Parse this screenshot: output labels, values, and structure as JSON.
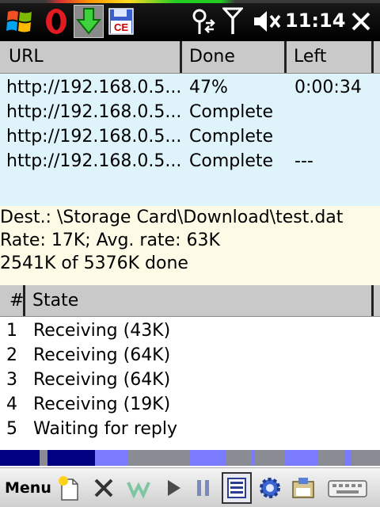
{
  "status_bar": {
    "time": "11:14",
    "icons": {
      "start": "windows-start-icon",
      "opera": "opera-browser-icon",
      "download_app": "download-manager-icon",
      "save": "floppy-ce-icon",
      "connection": "connectivity-icon",
      "signal": "signal-strength-icon",
      "volume": "speaker-muted-icon",
      "close": "close-icon"
    },
    "ce_text": "CE"
  },
  "downloads_table": {
    "columns": [
      "URL",
      "Done",
      "Left"
    ],
    "rows": [
      {
        "url": "http://192.168.0.5...",
        "done": "47%",
        "left": "0:00:34"
      },
      {
        "url": "http://192.168.0.5...",
        "done": "Complete",
        "left": ""
      },
      {
        "url": "http://192.168.0.5...",
        "done": "Complete",
        "left": ""
      },
      {
        "url": "http://192.168.0.5...",
        "done": "Complete",
        "left": "---"
      }
    ]
  },
  "info": {
    "dest": "Dest.: \\Storage Card\\Download\\test.dat",
    "rate": "Rate: 17K; Avg. rate: 63K",
    "done": "2541K of 5376K done"
  },
  "threads_table": {
    "columns": [
      "#",
      "State"
    ],
    "rows": [
      {
        "num": "1",
        "state": "Receiving (43K)"
      },
      {
        "num": "2",
        "state": "Receiving (64K)"
      },
      {
        "num": "3",
        "state": "Receiving (64K)"
      },
      {
        "num": "4",
        "state": "Receiving (19K)"
      },
      {
        "num": "5",
        "state": "Waiting for reply"
      }
    ]
  },
  "progress_map": {
    "colors": {
      "downloaded": "#000080",
      "active": "#7b7bff",
      "pending": "#8b8b93"
    }
  },
  "menu_bar": {
    "menu_label": "Menu",
    "toolbar": [
      "new-download-icon",
      "delete-icon",
      "play-icon",
      "pause-icon",
      "view-details-icon",
      "settings-gear-icon",
      "save-disk-icon",
      "keyboard-icon"
    ]
  },
  "colors": {
    "status_bar_bg": "#000000",
    "header_bg": "#c9c9c9",
    "download_list_bg": "#dff3fb",
    "info_bg": "#fdfbe6"
  }
}
